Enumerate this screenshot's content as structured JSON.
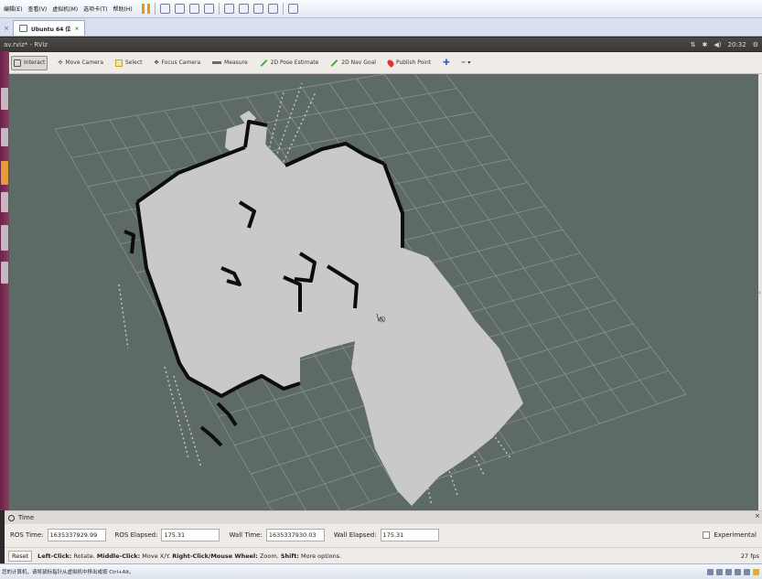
{
  "vm_menubar": {
    "items": [
      "编辑(E)",
      "查看(V)",
      "虚拟机(M)",
      "选项卡(T)",
      "帮助(H)"
    ]
  },
  "vm_tabs": {
    "active_tab_label": "Ubuntu 64 位"
  },
  "ubuntu_panel": {
    "window_title": "av.rviz* - RViz",
    "clock": "20:32"
  },
  "toolbar": {
    "tools": [
      {
        "label": "Interact",
        "icon": "cursor-icon",
        "active": true
      },
      {
        "label": "Move Camera",
        "icon": "move-camera-icon",
        "active": false
      },
      {
        "label": "Select",
        "icon": "select-icon",
        "active": false
      },
      {
        "label": "Focus Camera",
        "icon": "focus-camera-icon",
        "active": false
      },
      {
        "label": "Measure",
        "icon": "measure-icon",
        "active": false
      },
      {
        "label": "2D Pose Estimate",
        "icon": "pose-estimate-icon",
        "active": false
      },
      {
        "label": "2D Nav Goal",
        "icon": "nav-goal-icon",
        "active": false
      },
      {
        "label": "Publish Point",
        "icon": "publish-point-icon",
        "active": false
      }
    ]
  },
  "view": {
    "background_color": "#5e6a66",
    "grid_color": "#8e9794",
    "free_space_color": "#c9c9c9",
    "wall_color": "#0d0d0d"
  },
  "time_panel": {
    "title": "Time",
    "ros_time_label": "ROS Time:",
    "ros_time_value": "1635337929.99",
    "ros_elapsed_label": "ROS Elapsed:",
    "ros_elapsed_value": "175.31",
    "wall_time_label": "Wall Time:",
    "wall_time_value": "1635337930.03",
    "wall_elapsed_label": "Wall Elapsed:",
    "wall_elapsed_value": "175.31",
    "experimental_label": "Experimental"
  },
  "status_bar": {
    "reset_label": "Reset",
    "left_click_bold": "Left-Click:",
    "left_click_text": "Rotate.",
    "middle_click_bold": "Middle-Click:",
    "middle_click_text": "Move X/Y.",
    "right_click_bold": "Right-Click/Mouse Wheel:",
    "right_click_text": "Zoom.",
    "shift_bold": "Shift:",
    "shift_text": "More options.",
    "fps": "27 fps"
  },
  "vm_hint": {
    "text": "您的计算机，请将鼠标指针从虚拟机中移出或按 Ctrl+Alt。"
  }
}
